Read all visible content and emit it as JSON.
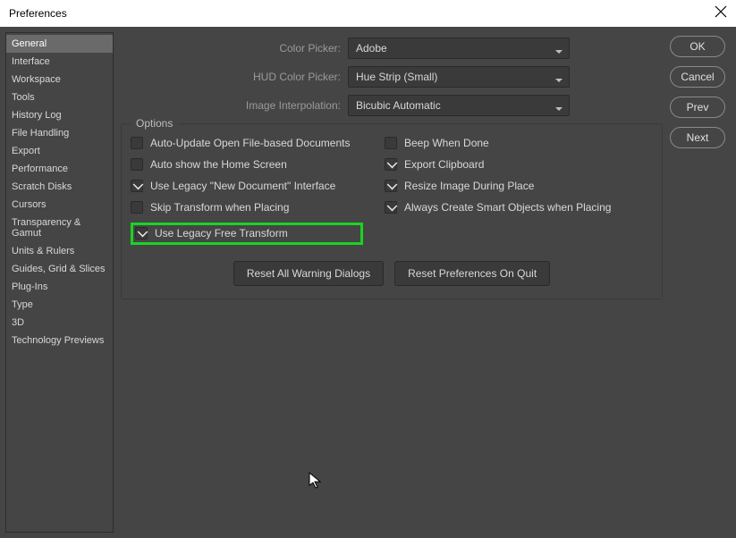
{
  "titlebar": {
    "title": "Preferences"
  },
  "sidebar": {
    "items": [
      {
        "label": "General",
        "selected": true
      },
      {
        "label": "Interface"
      },
      {
        "label": "Workspace"
      },
      {
        "label": "Tools"
      },
      {
        "label": "History Log"
      },
      {
        "label": "File Handling"
      },
      {
        "label": "Export"
      },
      {
        "label": "Performance"
      },
      {
        "label": "Scratch Disks"
      },
      {
        "label": "Cursors"
      },
      {
        "label": "Transparency & Gamut"
      },
      {
        "label": "Units & Rulers"
      },
      {
        "label": "Guides, Grid & Slices"
      },
      {
        "label": "Plug-Ins"
      },
      {
        "label": "Type"
      },
      {
        "label": "3D"
      },
      {
        "label": "Technology Previews"
      }
    ]
  },
  "form": {
    "color_picker": {
      "label": "Color Picker:",
      "value": "Adobe"
    },
    "hud_color_picker": {
      "label": "HUD Color Picker:",
      "value": "Hue Strip (Small)"
    },
    "image_interpolation": {
      "label": "Image Interpolation:",
      "value": "Bicubic Automatic"
    }
  },
  "options": {
    "legend": "Options",
    "left": [
      {
        "label": "Auto-Update Open File-based Documents",
        "checked": false
      },
      {
        "label": "Auto show the Home Screen",
        "checked": false
      },
      {
        "label": "Use Legacy \"New Document\" Interface",
        "checked": true
      },
      {
        "label": "Skip Transform when Placing",
        "checked": false
      },
      {
        "label": "Use Legacy Free Transform",
        "checked": true,
        "highlighted": true
      }
    ],
    "right": [
      {
        "label": "Beep When Done",
        "checked": false
      },
      {
        "label": "Export Clipboard",
        "checked": true
      },
      {
        "label": "Resize Image During Place",
        "checked": true
      },
      {
        "label": "Always Create Smart Objects when Placing",
        "checked": true
      }
    ]
  },
  "buttons": {
    "reset_warnings": "Reset All Warning Dialogs",
    "reset_prefs": "Reset Preferences On Quit",
    "ok": "OK",
    "cancel": "Cancel",
    "prev": "Prev",
    "next": "Next"
  },
  "colors": {
    "bg": "#454545",
    "highlight": "#18d422"
  }
}
